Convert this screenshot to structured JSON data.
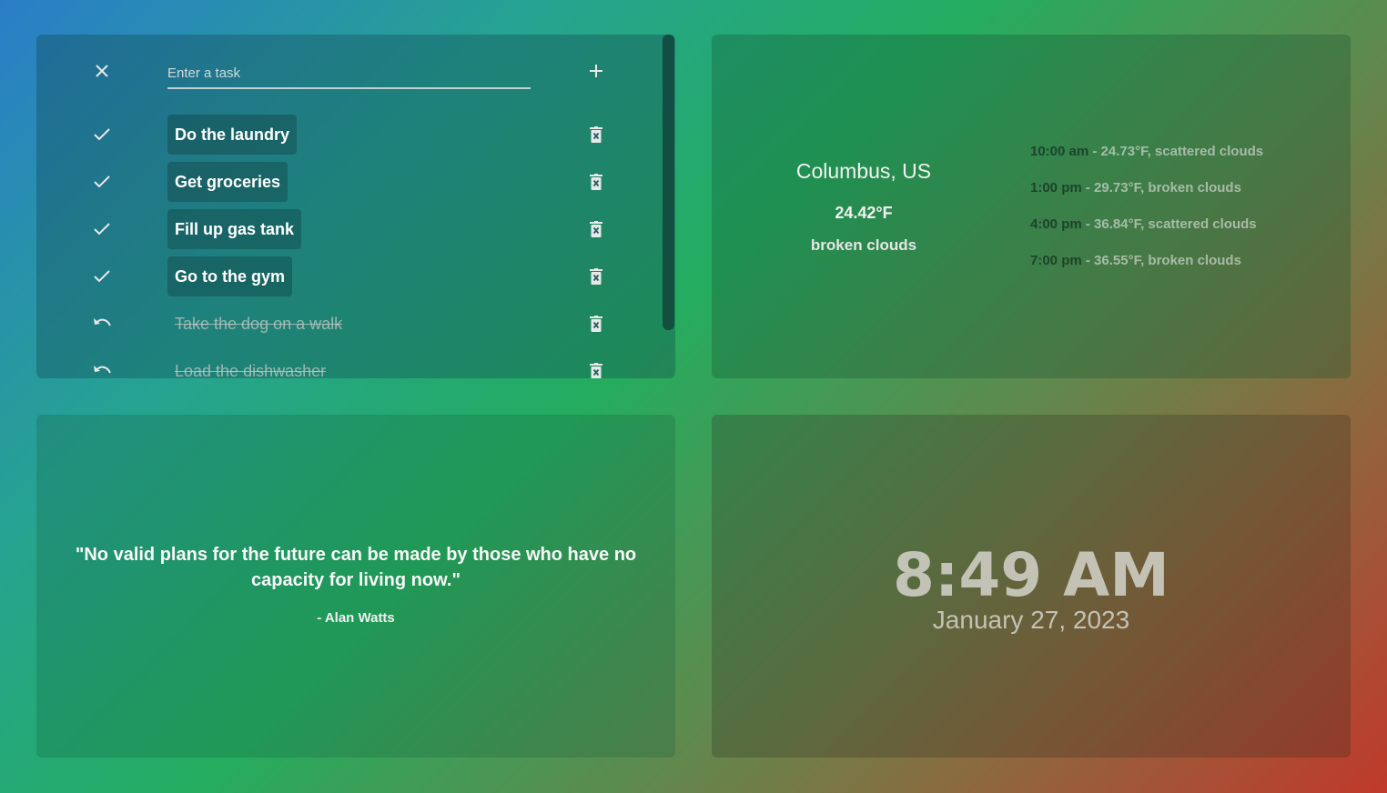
{
  "todo": {
    "input_placeholder": "Enter a task",
    "clear_icon": "close-icon",
    "add_icon": "plus-icon",
    "tasks": [
      {
        "label": "Do the laundry",
        "done": false
      },
      {
        "label": "Get groceries",
        "done": false
      },
      {
        "label": "Fill up gas tank",
        "done": false
      },
      {
        "label": "Go to the gym",
        "done": false
      },
      {
        "label": "Take the dog on a walk",
        "done": true
      },
      {
        "label": "Load the dishwasher",
        "done": true
      }
    ]
  },
  "weather": {
    "city": "Columbus, US",
    "temperature": "24.42°F",
    "description": "broken clouds",
    "forecast": [
      {
        "time": "10:00 am",
        "info": " - 24.73°F, scattered clouds"
      },
      {
        "time": "1:00 pm",
        "info": " - 29.73°F, broken clouds"
      },
      {
        "time": "4:00 pm",
        "info": " - 36.84°F, scattered clouds"
      },
      {
        "time": "7:00 pm",
        "info": " - 36.55°F, broken clouds"
      }
    ]
  },
  "quote": {
    "text": "\"No valid plans for the future can be made by those who have no capacity for living now.\"",
    "author": "- Alan Watts"
  },
  "clock": {
    "time": "8:49 AM",
    "date": "January 27, 2023"
  }
}
